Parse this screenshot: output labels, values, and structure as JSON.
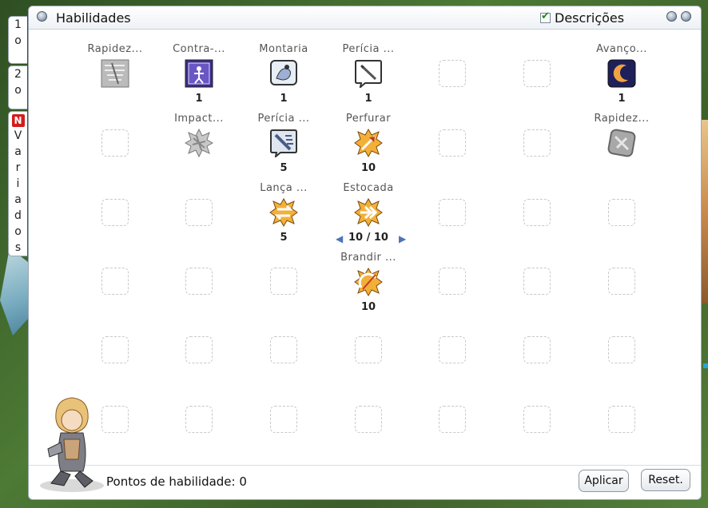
{
  "window": {
    "title": "Habilidades",
    "descriptions_label": "Descrições",
    "descriptions_checked": true
  },
  "tabs": [
    {
      "label_chars": [
        "1",
        "o"
      ]
    },
    {
      "label_chars": [
        "2",
        "o"
      ]
    },
    {
      "badge": "N",
      "label_chars": [
        "V",
        "a",
        "r",
        "i",
        "a",
        "d",
        "o",
        "s"
      ]
    }
  ],
  "skills": [
    {
      "name": "Rapidez...",
      "level": "",
      "icon": "dagger-crossed-icon"
    },
    {
      "name": "Contra-...",
      "level": "1",
      "icon": "counter-attack-icon"
    },
    {
      "name": "Montaria",
      "level": "1",
      "icon": "riding-icon"
    },
    {
      "name": "Perícia ...",
      "level": "1",
      "icon": "spear-mastery-icon"
    },
    {
      "name": "Avanço...",
      "level": "1",
      "icon": "crescent-charge-icon"
    },
    {
      "name": "Impact...",
      "level": "",
      "icon": "impact-icon"
    },
    {
      "name": "Perícia ...",
      "level": "5",
      "icon": "cavalry-mastery-icon"
    },
    {
      "name": "Perfurar",
      "level": "10",
      "icon": "pierce-icon"
    },
    {
      "name": "Rapidez...",
      "level": "",
      "icon": "spear-quicken-icon"
    },
    {
      "name": "Lança ...",
      "level": "5",
      "icon": "spear-boomerang-icon"
    },
    {
      "name": "Estocada",
      "level": "10 / 10",
      "icon": "spear-stab-icon"
    },
    {
      "name": "Brandir ...",
      "level": "10",
      "icon": "brandish-spear-icon"
    }
  ],
  "footer": {
    "points": "Pontos de habilidade: 0",
    "apply": "Aplicar",
    "reset": "Reset."
  },
  "colors": {
    "accent": "#4d74b5",
    "border": "#9aa7b4",
    "badge": "#d21d1d"
  }
}
